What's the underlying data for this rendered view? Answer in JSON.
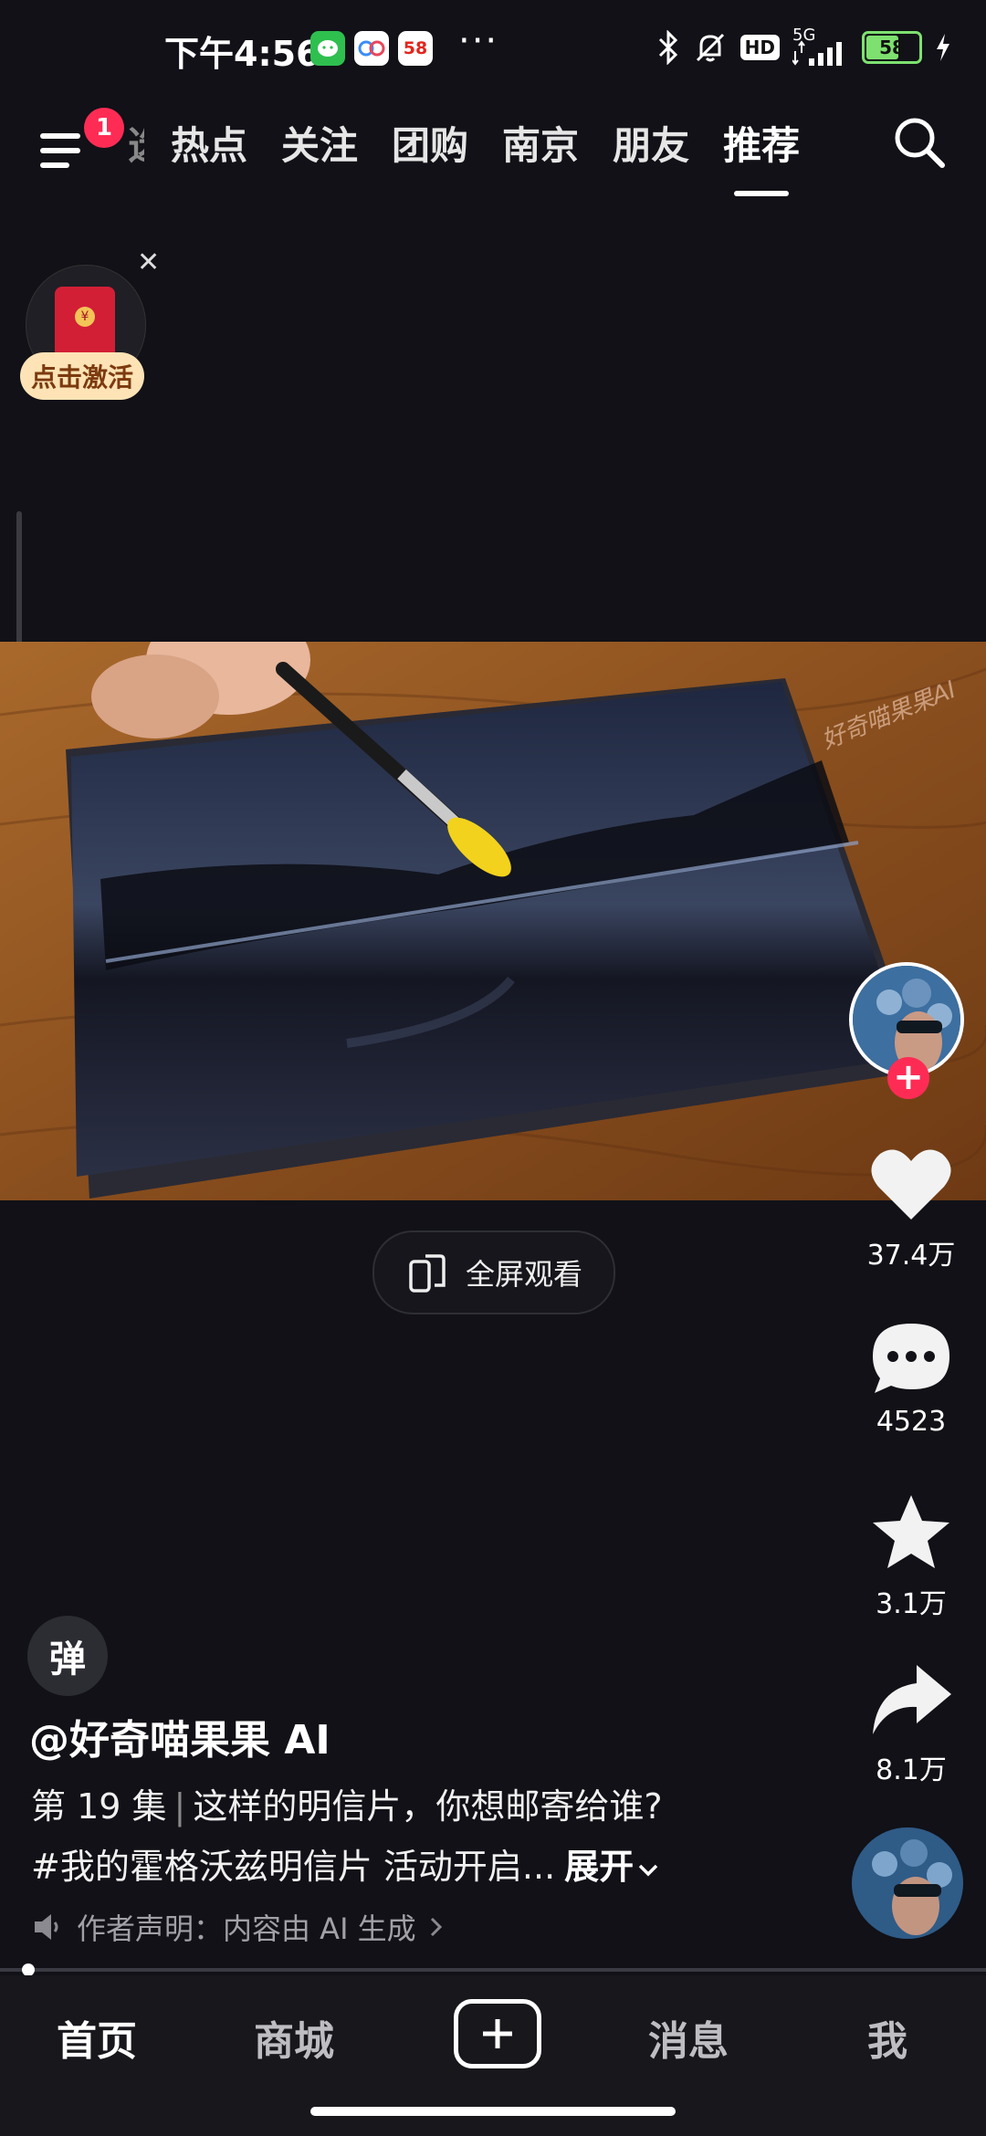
{
  "status_bar": {
    "time": "下午4:56",
    "app_icons": [
      "wechat-icon",
      "baidu-netdisk-icon",
      "58-app-icon"
    ],
    "app_58_label": "58",
    "more_dots": "···",
    "network": "5G",
    "battery_level": "58"
  },
  "nav": {
    "menu_badge": "1",
    "tabs": [
      "选",
      "热点",
      "关注",
      "团购",
      "南京",
      "朋友",
      "推荐"
    ],
    "active_tab": "推荐"
  },
  "red_packet": {
    "label": "点击激活"
  },
  "video": {
    "watermark": "好奇喵果果AI"
  },
  "fullscreen": {
    "label": "全屏观看"
  },
  "actions": {
    "likes": "37.4万",
    "comments": "4523",
    "favorites": "3.1万",
    "shares": "8.1万"
  },
  "info": {
    "danmu_label": "弹",
    "author": "@好奇喵果果 AI",
    "episode": "第 19 集",
    "title": "这样的明信片，你想邮寄给谁?",
    "hashtag_line": "#我的霍格沃兹明信片 活动开启...",
    "expand": "展开",
    "declaration": "作者声明：内容由 AI 生成"
  },
  "bottom_nav": {
    "home": "首页",
    "mall": "商城",
    "messages": "消息",
    "me": "我"
  },
  "colors": {
    "accent": "#fe2c55",
    "background": "#111117",
    "battery": "#7ee06f"
  }
}
